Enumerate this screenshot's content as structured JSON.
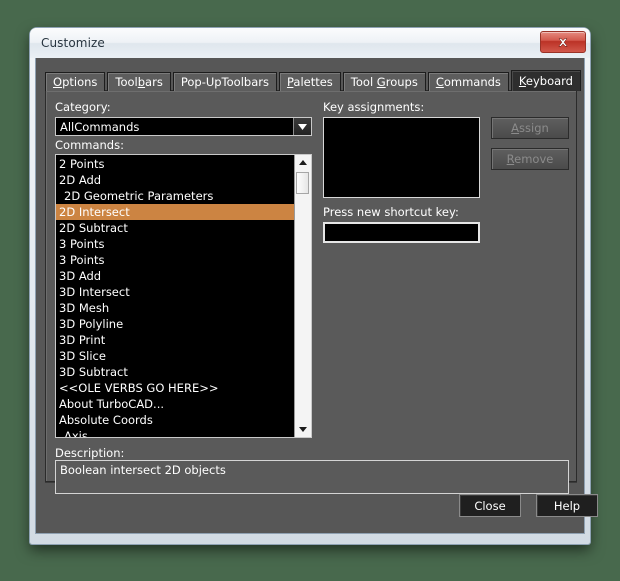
{
  "window": {
    "title": "Customize",
    "close_icon": "close-x-icon"
  },
  "tabs": [
    {
      "label": "Options",
      "accel": "O",
      "active": false
    },
    {
      "label": "Toolbars",
      "accel": "b",
      "active": false
    },
    {
      "label": "Pop-UpToolbars",
      "accel": "",
      "active": false
    },
    {
      "label": "Palettes",
      "accel": "P",
      "active": false
    },
    {
      "label": "Tool Groups",
      "accel": "G",
      "active": false
    },
    {
      "label": "Commands",
      "accel": "C",
      "active": false
    },
    {
      "label": "Keyboard",
      "accel": "K",
      "active": true
    }
  ],
  "panel": {
    "category_label": "Category:",
    "category_value": "AllCommands",
    "category_arrow_icon": "chevron-down-icon",
    "commands_label": "Commands:",
    "commands": [
      {
        "text": "2 Points",
        "selected": false,
        "indent": false
      },
      {
        "text": "2D Add",
        "selected": false,
        "indent": false
      },
      {
        "text": "2D Geometric Parameters",
        "selected": false,
        "indent": true
      },
      {
        "text": "2D Intersect",
        "selected": true,
        "indent": false
      },
      {
        "text": "2D Subtract",
        "selected": false,
        "indent": false
      },
      {
        "text": "3 Points",
        "selected": false,
        "indent": false
      },
      {
        "text": "3 Points",
        "selected": false,
        "indent": false
      },
      {
        "text": "3D Add",
        "selected": false,
        "indent": false
      },
      {
        "text": "3D Intersect",
        "selected": false,
        "indent": false
      },
      {
        "text": "3D Mesh",
        "selected": false,
        "indent": false
      },
      {
        "text": "3D Polyline",
        "selected": false,
        "indent": false
      },
      {
        "text": "3D Print",
        "selected": false,
        "indent": false
      },
      {
        "text": "3D Slice",
        "selected": false,
        "indent": false
      },
      {
        "text": "3D Subtract",
        "selected": false,
        "indent": false
      },
      {
        "text": "<<OLE VERBS GO HERE>>",
        "selected": false,
        "indent": false
      },
      {
        "text": "About TurboCAD...",
        "selected": false,
        "indent": false
      },
      {
        "text": "Absolute Coords",
        "selected": false,
        "indent": false
      },
      {
        "text": "Axis",
        "selected": false,
        "indent": true
      }
    ],
    "scroll_up_icon": "scroll-up-arrow-icon",
    "scroll_down_icon": "scroll-down-arrow-icon",
    "key_assignments_label": "Key assignments:",
    "key_assignments": [],
    "assign_label": "Assign",
    "assign_accel": "A",
    "remove_label": "Remove",
    "remove_accel": "R",
    "shortcut_label": "Press new shortcut key:",
    "shortcut_value": "",
    "description_label": "Description:",
    "description_text": "Boolean intersect 2D objects"
  },
  "footer": {
    "close_label": "Close",
    "help_label": "Help"
  },
  "colors": {
    "desktop": "#48694d",
    "dialog_bg": "#575757",
    "panel_bg": "#5a5a5a",
    "list_bg": "#000000",
    "selection": "#cc8442",
    "close_button": "#bb3226",
    "active_tab": "#2e2e2e"
  }
}
